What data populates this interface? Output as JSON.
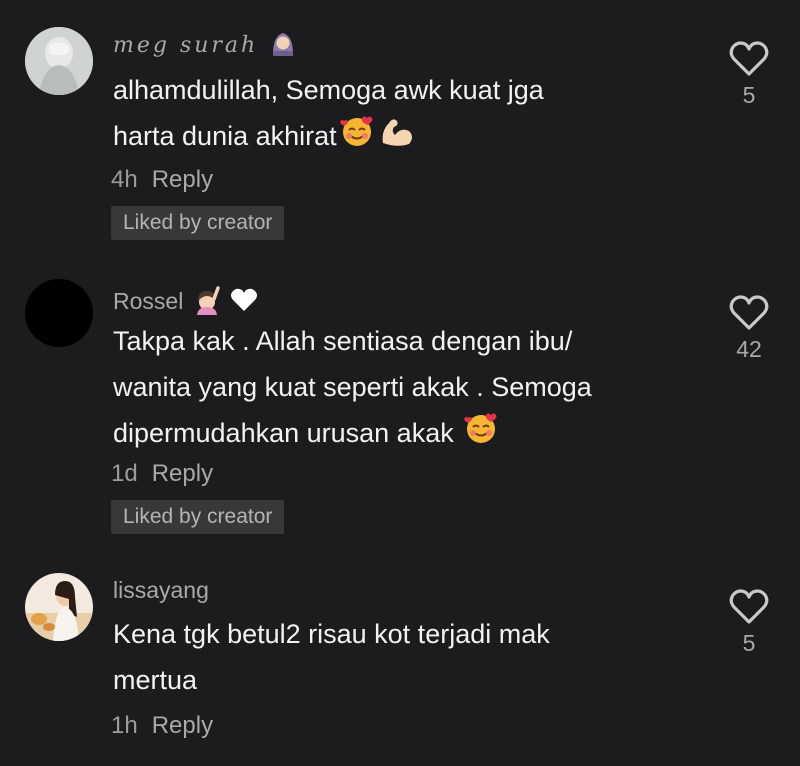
{
  "comments": [
    {
      "username": "meg surah",
      "text_lines": [
        "alhamdulillah, Semoga awk kuat jga",
        "harta dunia akhirat"
      ],
      "time": "4h",
      "reply_label": "Reply",
      "liked_label": "Liked by creator",
      "likes": "5",
      "emojis": [
        "hijab-woman-emoji",
        "smiling-hearts-emoji",
        "flexed-biceps-emoji"
      ]
    },
    {
      "username": "Rossel",
      "text_lines": [
        "Takpa kak . Allah sentiasa dengan ibu/",
        "wanita yang kuat seperti akak . Semoga",
        "dipermudahkan urusan akak"
      ],
      "time": "1d",
      "reply_label": "Reply",
      "liked_label": "Liked by creator",
      "likes": "42",
      "emojis": [
        "raising-hand-emoji",
        "white-heart-emoji",
        "smiling-hearts-emoji"
      ]
    },
    {
      "username": "lissayang",
      "text_lines": [
        "Kena tgk betul2 risau kot terjadi mak",
        "mertua"
      ],
      "time": "1h",
      "reply_label": "Reply",
      "likes": "5"
    }
  ],
  "colors": {
    "background": "#1c1c1e",
    "text": "#f2f2f2",
    "muted": "#a9a9ab",
    "liked_badge": "#38383a"
  }
}
